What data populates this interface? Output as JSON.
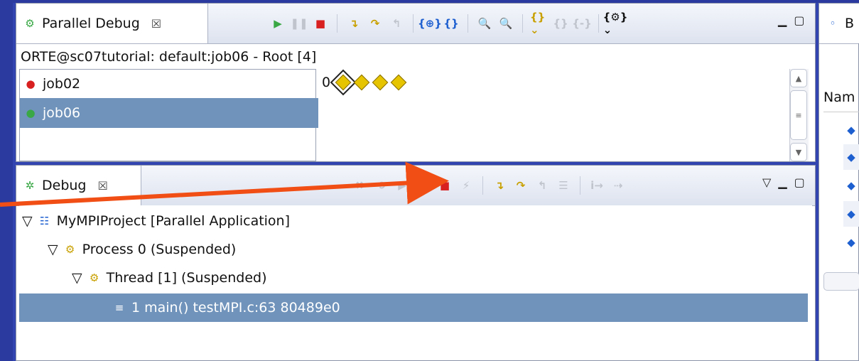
{
  "parallel_debug": {
    "tab_label": "Parallel Debug",
    "tab_close": "☒",
    "status_line": "ORTE@sc07tutorial: default:job06 - Root [4]",
    "jobs": [
      {
        "label": "job02",
        "selected": false
      },
      {
        "label": "job06",
        "selected": true
      }
    ],
    "process_set_index": "0",
    "process_count": 4
  },
  "debug": {
    "tab_label": "Debug",
    "tab_close": "☒",
    "tree": [
      {
        "label": "MyMPIProject [Parallel Application]",
        "level": 0,
        "icon": "launch-icon"
      },
      {
        "label": "Process 0 (Suspended)",
        "level": 1,
        "icon": "gears-icon"
      },
      {
        "label": "Thread [1] (Suspended)",
        "level": 2,
        "icon": "thread-icon"
      },
      {
        "label": "1 main() testMPI.c:63 80489e0",
        "level": 3,
        "icon": "stack-frame-icon",
        "selected": true
      }
    ]
  },
  "breakpoints": {
    "tab_label": "B",
    "column_header": "Nam"
  },
  "colors": {
    "selection": "#6f93ba",
    "annotation_arrow": "#f04e14",
    "background": "#3244b0"
  }
}
